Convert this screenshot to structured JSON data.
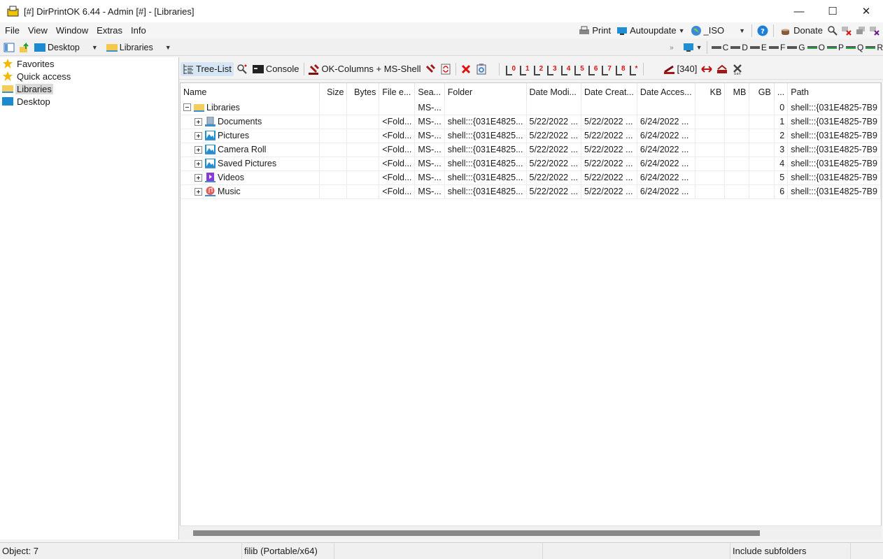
{
  "window": {
    "title": "[#] DirPrintOK 6.44 - Admin [#] - [Libraries]",
    "controls": {
      "minimize": "—",
      "maximize": "☐",
      "close": "✕"
    }
  },
  "menu": {
    "items": [
      "File",
      "View",
      "Window",
      "Extras",
      "Info"
    ],
    "right": {
      "print": "Print",
      "autoupdate": "Autoupdate",
      "iso": "_ISO",
      "donate": "Donate"
    }
  },
  "addressbar": {
    "location": "Desktop",
    "folder": "Libraries",
    "drives": [
      "C",
      "D",
      "E",
      "F",
      "G",
      "O",
      "P",
      "Q",
      "R"
    ],
    "more": "»"
  },
  "tree": {
    "items": [
      {
        "label": "Favorites",
        "icon": "star-icon"
      },
      {
        "label": "Quick access",
        "icon": "star-icon"
      },
      {
        "label": "Libraries",
        "icon": "folder-icon",
        "selected": true
      },
      {
        "label": "Desktop",
        "icon": "desktop-icon"
      }
    ]
  },
  "toolbar": {
    "tree_list": "Tree-List",
    "console": "Console",
    "ok_columns": "OK-Columns + MS-Shell",
    "levels": [
      "0",
      "1",
      "2",
      "3",
      "4",
      "5",
      "6",
      "7",
      "8",
      "*"
    ],
    "count": "[340]"
  },
  "grid": {
    "columns": [
      "Name",
      "Size",
      "Bytes",
      "File e...",
      "Sea...",
      "Folder",
      "Date Modi...",
      "Date Creat...",
      "Date Acces...",
      "KB",
      "MB",
      "GB",
      "...",
      "Path"
    ],
    "root": {
      "name": "Libraries",
      "search": "MS-...",
      "index": "0",
      "path": "shell:::{031E4825-7B9"
    },
    "rows": [
      {
        "name": "Documents",
        "icon": "documents-icon",
        "ext": "<Fold...",
        "search": "MS-...",
        "folder": "shell:::{031E4825...",
        "modified": "5/22/2022 ...",
        "created": "5/22/2022 ...",
        "accessed": "6/24/2022 ...",
        "index": "1",
        "path": "shell:::{031E4825-7B9"
      },
      {
        "name": "Pictures",
        "icon": "pictures-icon",
        "ext": "<Fold...",
        "search": "MS-...",
        "folder": "shell:::{031E4825...",
        "modified": "5/22/2022 ...",
        "created": "5/22/2022 ...",
        "accessed": "6/24/2022 ...",
        "index": "2",
        "path": "shell:::{031E4825-7B9"
      },
      {
        "name": "Camera Roll",
        "icon": "pictures-icon",
        "ext": "<Fold...",
        "search": "MS-...",
        "folder": "shell:::{031E4825...",
        "modified": "5/22/2022 ...",
        "created": "5/22/2022 ...",
        "accessed": "6/24/2022 ...",
        "index": "3",
        "path": "shell:::{031E4825-7B9"
      },
      {
        "name": "Saved Pictures",
        "icon": "pictures-icon",
        "ext": "<Fold...",
        "search": "MS-...",
        "folder": "shell:::{031E4825...",
        "modified": "5/22/2022 ...",
        "created": "5/22/2022 ...",
        "accessed": "6/24/2022 ...",
        "index": "4",
        "path": "shell:::{031E4825-7B9"
      },
      {
        "name": "Videos",
        "icon": "videos-icon",
        "ext": "<Fold...",
        "search": "MS-...",
        "folder": "shell:::{031E4825...",
        "modified": "5/22/2022 ...",
        "created": "5/22/2022 ...",
        "accessed": "6/24/2022 ...",
        "index": "5",
        "path": "shell:::{031E4825-7B9"
      },
      {
        "name": "Music",
        "icon": "music-icon",
        "ext": "<Fold...",
        "search": "MS-...",
        "folder": "shell:::{031E4825...",
        "modified": "5/22/2022 ...",
        "created": "5/22/2022 ...",
        "accessed": "6/24/2022 ...",
        "index": "6",
        "path": "shell:::{031E4825-7B9"
      }
    ]
  },
  "statusbar": {
    "objects": "Object: 7",
    "mode": "filib (Portable/x64)",
    "subfolders": "Include subfolders"
  },
  "colors": {
    "accent": "#0078d4",
    "selection": "#d6e6f5",
    "red": "#d11111"
  }
}
